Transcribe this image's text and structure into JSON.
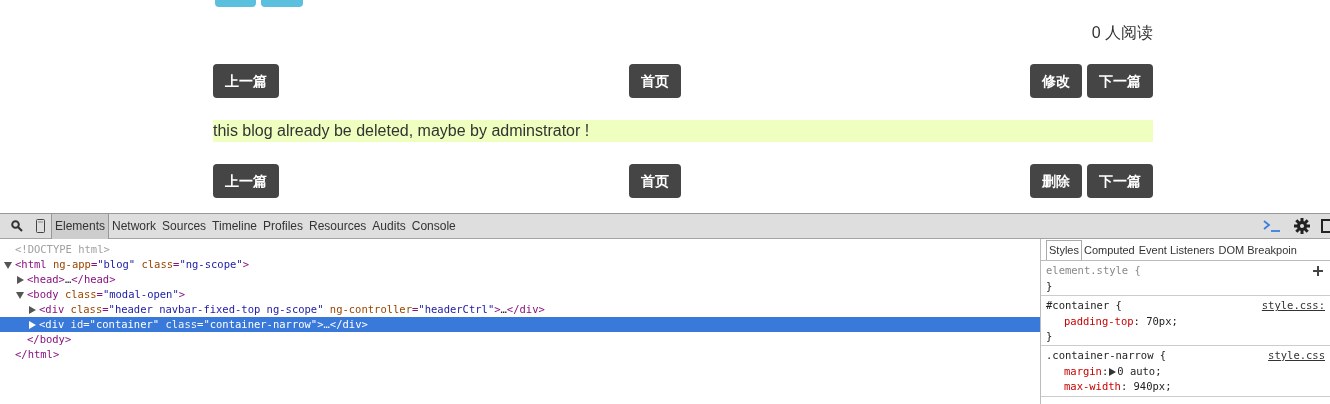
{
  "page": {
    "read_count": "0 人阅读",
    "top_buttons": {
      "prev": "上一篇",
      "home": "首页",
      "actions": [
        "修改",
        "下一篇"
      ]
    },
    "notice": "this blog already be deleted, maybe by adminstrator !",
    "bottom_buttons": {
      "prev": "上一篇",
      "home": "首页",
      "actions": [
        "删除",
        "下一篇"
      ]
    }
  },
  "devtools": {
    "tabs": [
      {
        "label": "Elements",
        "selected": true
      },
      {
        "label": "Network",
        "selected": false
      },
      {
        "label": "Sources",
        "selected": false
      },
      {
        "label": "Timeline",
        "selected": false
      },
      {
        "label": "Profiles",
        "selected": false
      },
      {
        "label": "Resources",
        "selected": false
      },
      {
        "label": "Audits",
        "selected": false
      },
      {
        "label": "Console",
        "selected": false
      }
    ],
    "tree": [
      {
        "tokens": [
          {
            "kind": "doctype",
            "text": "<!DOCTYPE html>"
          }
        ],
        "selected": false
      },
      {
        "tokens": [
          {
            "kind": "tag",
            "text": "<html"
          },
          {
            "kind": "attr",
            "text": " ng-app"
          },
          {
            "kind": "tag",
            "text": "="
          },
          {
            "kind": "value",
            "text": "\"blog\""
          },
          {
            "kind": "attr",
            "text": " class"
          },
          {
            "kind": "tag",
            "text": "="
          },
          {
            "kind": "value",
            "text": "\"ng-scope\""
          },
          {
            "kind": "tag",
            "text": ">"
          }
        ],
        "expanded": true,
        "selected": false,
        "children": [
          {
            "tokens": [
              {
                "kind": "tag",
                "text": "<head>"
              },
              {
                "kind": "text",
                "text": "…"
              },
              {
                "kind": "tag",
                "text": "</head>"
              }
            ],
            "expanded": false,
            "selected": false
          },
          {
            "tokens": [
              {
                "kind": "tag",
                "text": "<body"
              },
              {
                "kind": "attr",
                "text": " class"
              },
              {
                "kind": "tag",
                "text": "="
              },
              {
                "kind": "value",
                "text": "\"modal-open\""
              },
              {
                "kind": "tag",
                "text": ">"
              }
            ],
            "expanded": true,
            "selected": false,
            "children": [
              {
                "tokens": [
                  {
                    "kind": "tag",
                    "text": "<div"
                  },
                  {
                    "kind": "attr",
                    "text": " class"
                  },
                  {
                    "kind": "tag",
                    "text": "="
                  },
                  {
                    "kind": "value",
                    "text": "\"header navbar-fixed-top ng-scope\""
                  },
                  {
                    "kind": "attr",
                    "text": " ng-controller"
                  },
                  {
                    "kind": "tag",
                    "text": "="
                  },
                  {
                    "kind": "value",
                    "text": "\"headerCtrl\""
                  },
                  {
                    "kind": "tag",
                    "text": ">"
                  },
                  {
                    "kind": "text",
                    "text": "…"
                  },
                  {
                    "kind": "tag",
                    "text": "</div>"
                  }
                ],
                "expanded": false,
                "selected": false
              },
              {
                "tokens": [
                  {
                    "kind": "tag",
                    "text": "<div"
                  },
                  {
                    "kind": "attr",
                    "text": " id"
                  },
                  {
                    "kind": "tag",
                    "text": "="
                  },
                  {
                    "kind": "value",
                    "text": "\"container\""
                  },
                  {
                    "kind": "attr",
                    "text": " class"
                  },
                  {
                    "kind": "tag",
                    "text": "="
                  },
                  {
                    "kind": "value",
                    "text": "\"container-narrow\""
                  },
                  {
                    "kind": "tag",
                    "text": ">"
                  },
                  {
                    "kind": "text",
                    "text": "…"
                  },
                  {
                    "kind": "tag",
                    "text": "</div>"
                  }
                ],
                "expanded": false,
                "selected": true
              }
            ],
            "close": "</body>"
          }
        ],
        "close": "</html>"
      }
    ],
    "side_tabs": [
      {
        "label": "Styles",
        "selected": true
      },
      {
        "label": "Computed",
        "selected": false
      },
      {
        "label": "Event Listeners",
        "selected": false
      },
      {
        "label": "DOM Breakpoin",
        "selected": false
      }
    ],
    "rules": [
      {
        "selector": "element.style {",
        "close": "}",
        "inline": true
      },
      {
        "selector": "#container {",
        "source": "style.css:",
        "close": "}",
        "properties": [
          {
            "name": "padding-top",
            "value": ": 70px;"
          }
        ]
      },
      {
        "selector": ".container-narrow {",
        "source": "style.css",
        "properties": [
          {
            "name": "margin",
            "value": ":",
            "expandable": true,
            "value2": "0 auto;"
          },
          {
            "name": "max-width",
            "value": ": 940px;"
          }
        ]
      }
    ]
  }
}
